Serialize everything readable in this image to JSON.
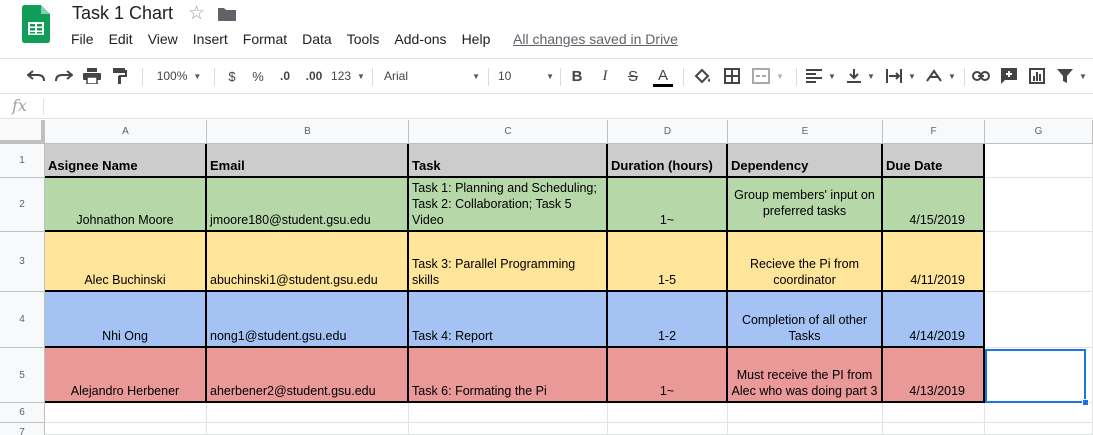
{
  "app": {
    "title": "Task 1 Chart",
    "saved_status": "All changes saved in Drive",
    "menu": [
      "File",
      "Edit",
      "View",
      "Insert",
      "Format",
      "Data",
      "Tools",
      "Add-ons",
      "Help"
    ]
  },
  "toolbar": {
    "zoom": "100%",
    "currency": "$",
    "percent": "%",
    "decimal_decrease": ".0",
    "decimal_increase": ".00",
    "more_formats": "123",
    "font": "Arial",
    "font_size": "10",
    "bold": "B",
    "italic": "I",
    "strikethrough": "S",
    "text_color": "A"
  },
  "formula_bar": {
    "label": "fx",
    "value": ""
  },
  "columns": [
    "A",
    "B",
    "C",
    "D",
    "E",
    "F",
    "G"
  ],
  "rows": [
    "1",
    "2",
    "3",
    "4",
    "5",
    "6",
    "7"
  ],
  "colors": {
    "header": "#cccccc",
    "row_green": "#b6d7a8",
    "row_yellow": "#ffe599",
    "row_blue": "#a4c2f4",
    "row_red": "#ea9999",
    "selection": "#1a73e8"
  },
  "table": {
    "headers": [
      "Asignee Name",
      "Email",
      "Task",
      "Duration (hours)",
      "Dependency",
      "Due Date"
    ],
    "records": [
      {
        "name": "Johnathon Moore",
        "email": "jmoore180@student.gsu.edu",
        "task": "Task 1: Planning and Scheduling; Task 2: Collaboration; Task 5 Video",
        "duration": "1~",
        "dependency": "Group members' input on preferred tasks",
        "due": "4/15/2019"
      },
      {
        "name": "Alec Buchinski",
        "email": "abuchinski1@student.gsu.edu",
        "task": "Task 3: Parallel Programming skills",
        "duration": "1-5",
        "dependency": "Recieve the Pi from coordinator",
        "due": "4/11/2019"
      },
      {
        "name": "Nhi Ong",
        "email": "nong1@student.gsu.edu",
        "task": "Task 4: Report",
        "duration": "1-2",
        "dependency": "Completion of all other Tasks",
        "due": "4/14/2019"
      },
      {
        "name": "Alejandro Herbener",
        "email": "aherbener2@student.gsu.edu",
        "task": "Task 6: Formating the Pi",
        "duration": "1~",
        "dependency": "Must receive the PI from Alec who was doing part 3",
        "due": "4/13/2019"
      }
    ]
  }
}
